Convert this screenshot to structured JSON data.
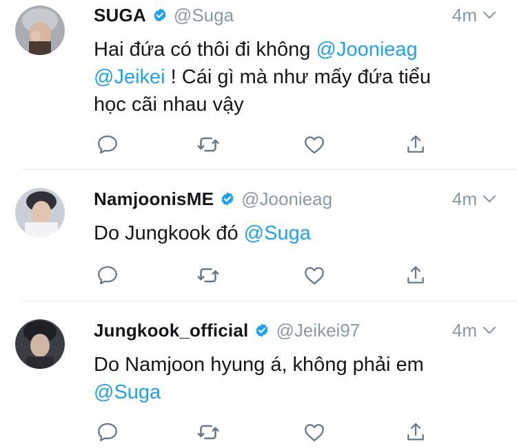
{
  "tweets": [
    {
      "name": "SUGA",
      "handle": "@Suga",
      "time": "4m",
      "text_parts": [
        "Hai đứa có thôi đi không ",
        "@Joonieag",
        "\n",
        "@Jeikei",
        " ! Cái gì mà như mấy đứa tiểu\nhọc cãi nhau vậy"
      ],
      "avatar_color": "#7b7f86"
    },
    {
      "name": "NamjoonisME",
      "handle": "@Joonieag",
      "time": "4m",
      "text_parts": [
        "Do Jungkook đó ",
        "@Suga"
      ],
      "avatar_color": "#8f97a3"
    },
    {
      "name": "Jungkook_official",
      "handle": "@Jeikei97",
      "time": "4m",
      "text_parts": [
        "Do Namjoon hyung á, không phải em\n",
        "@Suga"
      ],
      "avatar_color": "#4a4d55"
    }
  ],
  "icons": {
    "reply": "reply-icon",
    "retweet": "retweet-icon",
    "like": "like-icon",
    "share": "share-icon",
    "verified": "verified-badge-icon",
    "caret": "chevron-down-icon"
  },
  "colors": {
    "link": "#1da1f2",
    "secondary": "#8899a6",
    "text": "#14171a",
    "divider": "#e1e8ed",
    "icon": "#657786"
  }
}
